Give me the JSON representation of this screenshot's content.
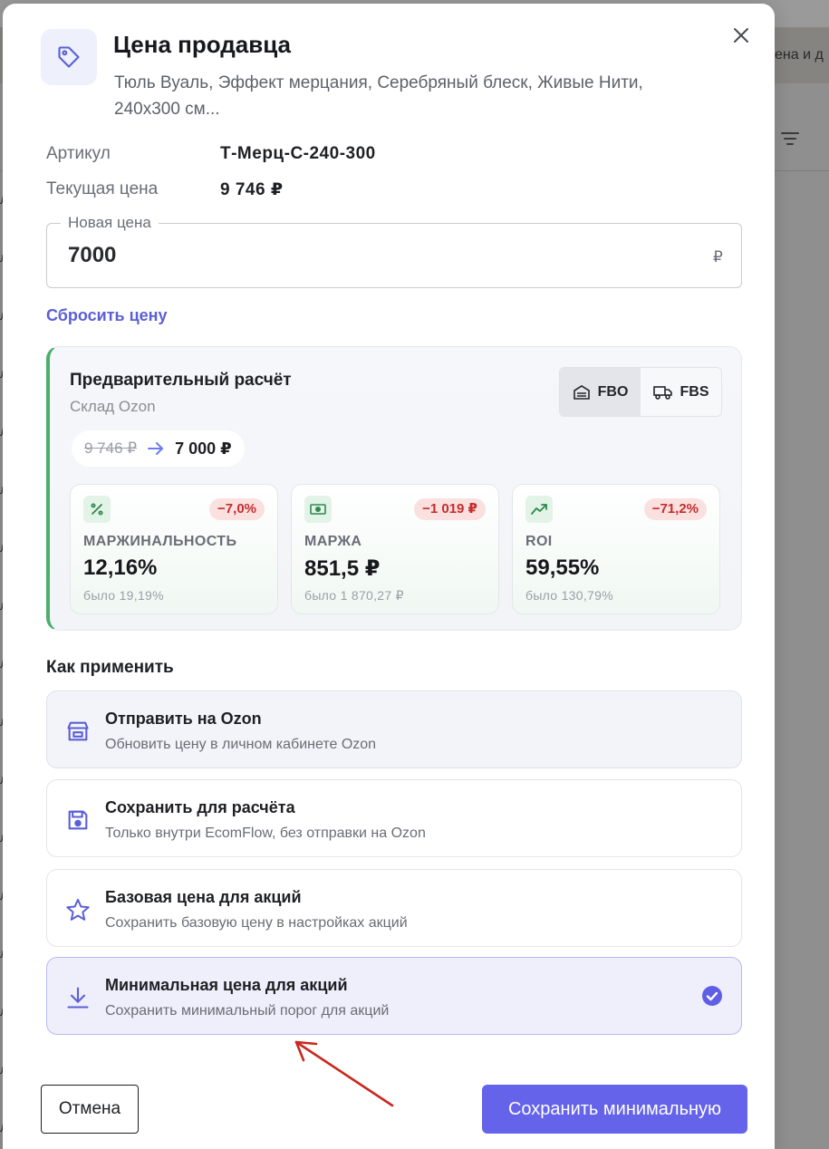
{
  "background": {
    "header_partial": "ена и д",
    "row_fragment": "ль"
  },
  "modal": {
    "title": "Цена продавца",
    "subtitle": "Тюль Вуаль, Эффект мерцания, Серебряный блеск, Живые Нити, 240х300 см...",
    "article_label": "Артикул",
    "article_value": "Т-Мерц-С-240-300",
    "current_price_label": "Текущая цена",
    "current_price_value": "9 746 ₽",
    "new_price_label": "Новая цена",
    "new_price_value": "7000",
    "currency": "₽",
    "reset_label": "Сбросить цену"
  },
  "calc": {
    "title": "Предварительный расчёт",
    "subtitle": "Склад Ozon",
    "toggle": [
      {
        "label": "FBO",
        "active": true
      },
      {
        "label": "FBS",
        "active": false
      }
    ],
    "old_price": "9 746 ₽",
    "new_price": "7 000 ₽",
    "metrics": [
      {
        "label": "МАРЖИНАЛЬНОСТЬ",
        "value": "12,16%",
        "was": "было 19,19%",
        "delta": "−7,0%",
        "icon": "percent-icon"
      },
      {
        "label": "МАРЖА",
        "value": "851,5 ₽",
        "was": "было 1 870,27 ₽",
        "delta": "−1 019 ₽",
        "icon": "money-icon"
      },
      {
        "label": "ROI",
        "value": "59,55%",
        "was": "было 130,79%",
        "delta": "−71,2%",
        "icon": "trend-icon"
      }
    ]
  },
  "apply": {
    "title": "Как применить",
    "options": [
      {
        "title": "Отправить на Ozon",
        "desc": "Обновить цену в личном кабинете Ozon",
        "icon": "store-icon"
      },
      {
        "title": "Сохранить для расчёта",
        "desc": "Только внутри EcomFlow, без отправки на Ozon",
        "icon": "save-icon"
      },
      {
        "title": "Базовая цена для акций",
        "desc": "Сохранить базовую цену в настройках акций",
        "icon": "star-icon"
      },
      {
        "title": "Минимальная цена для акций",
        "desc": "Сохранить минимальный порог для акций",
        "icon": "download-icon",
        "selected": true
      }
    ]
  },
  "footer": {
    "cancel_label": "Отмена",
    "save_label": "Сохранить минимальную"
  },
  "colors": {
    "accent": "#6563ea",
    "link": "#5b5fd6",
    "positive_bar": "#4cae6c",
    "negative_badge_bg": "#fbe0e0",
    "negative_badge_text": "#c42d2d",
    "annotation_arrow": "#c8281f"
  }
}
